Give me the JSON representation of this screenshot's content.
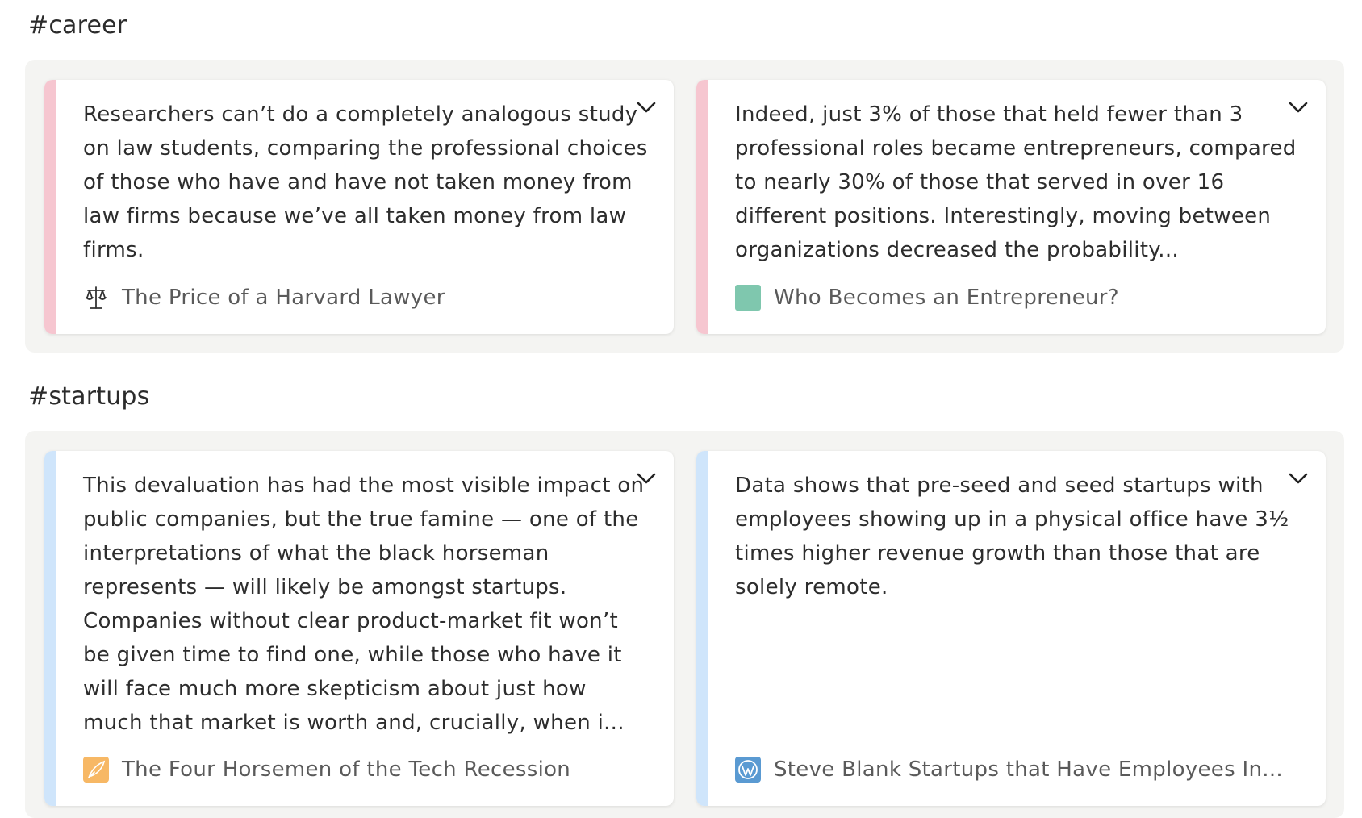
{
  "groups": [
    {
      "tag": "#career",
      "cards": [
        {
          "quote": "Researchers can’t do a completely analogous study on law students, comparing the professional choices of those who have and have not taken money from law firms because we’ve all taken money from law firms.",
          "source_title": "The Price of a Harvard Lawyer",
          "source_icon": "scales-icon",
          "accent_color": "#f6c6d0"
        },
        {
          "quote": "Indeed, just 3% of those that held fewer than 3 professional roles became entrepreneurs, compared to nearly 30% of those that served in over 16 different positions. Interestingly, moving between organizations decreased the probability...",
          "source_title": "Who Becomes an Entrepreneur?",
          "source_icon": "green-square-icon",
          "accent_color": "#f6c6d0"
        }
      ]
    },
    {
      "tag": "#startups",
      "cards": [
        {
          "quote": "This devaluation has had the most visible impact on public companies, but the true famine — one of the interpretations of what the black horseman represents — will likely be amongst startups. Companies without clear product-market fit won’t be given time to find one, while those who have it will face much more skepticism about just how much that market is worth and, crucially, when i...",
          "source_title": "The Four Horsemen of the Tech Recession",
          "source_icon": "quill-icon",
          "accent_color": "#cfe5fb"
        },
        {
          "quote": "Data shows that pre-seed and seed startups with employees showing up in a physical office have 3½ times higher revenue growth than those that are solely remote.",
          "source_title": "Steve Blank Startups that Have Employees In...",
          "source_icon": "wordpress-icon",
          "accent_color": "#cfe5fb"
        }
      ]
    }
  ]
}
